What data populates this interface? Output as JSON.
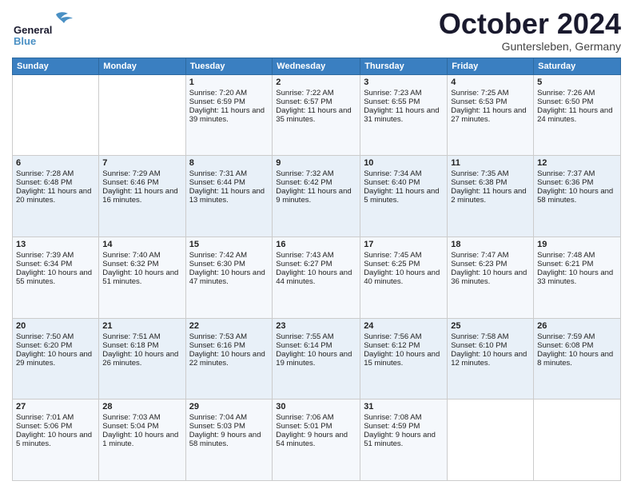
{
  "header": {
    "logo_general": "General",
    "logo_blue": "Blue",
    "month_title": "October 2024",
    "location": "Guntersleben, Germany"
  },
  "weekdays": [
    "Sunday",
    "Monday",
    "Tuesday",
    "Wednesday",
    "Thursday",
    "Friday",
    "Saturday"
  ],
  "weeks": [
    [
      {
        "day": "",
        "content": ""
      },
      {
        "day": "",
        "content": ""
      },
      {
        "day": "1",
        "content": "Sunrise: 7:20 AM\nSunset: 6:59 PM\nDaylight: 11 hours and 39 minutes."
      },
      {
        "day": "2",
        "content": "Sunrise: 7:22 AM\nSunset: 6:57 PM\nDaylight: 11 hours and 35 minutes."
      },
      {
        "day": "3",
        "content": "Sunrise: 7:23 AM\nSunset: 6:55 PM\nDaylight: 11 hours and 31 minutes."
      },
      {
        "day": "4",
        "content": "Sunrise: 7:25 AM\nSunset: 6:53 PM\nDaylight: 11 hours and 27 minutes."
      },
      {
        "day": "5",
        "content": "Sunrise: 7:26 AM\nSunset: 6:50 PM\nDaylight: 11 hours and 24 minutes."
      }
    ],
    [
      {
        "day": "6",
        "content": "Sunrise: 7:28 AM\nSunset: 6:48 PM\nDaylight: 11 hours and 20 minutes."
      },
      {
        "day": "7",
        "content": "Sunrise: 7:29 AM\nSunset: 6:46 PM\nDaylight: 11 hours and 16 minutes."
      },
      {
        "day": "8",
        "content": "Sunrise: 7:31 AM\nSunset: 6:44 PM\nDaylight: 11 hours and 13 minutes."
      },
      {
        "day": "9",
        "content": "Sunrise: 7:32 AM\nSunset: 6:42 PM\nDaylight: 11 hours and 9 minutes."
      },
      {
        "day": "10",
        "content": "Sunrise: 7:34 AM\nSunset: 6:40 PM\nDaylight: 11 hours and 5 minutes."
      },
      {
        "day": "11",
        "content": "Sunrise: 7:35 AM\nSunset: 6:38 PM\nDaylight: 11 hours and 2 minutes."
      },
      {
        "day": "12",
        "content": "Sunrise: 7:37 AM\nSunset: 6:36 PM\nDaylight: 10 hours and 58 minutes."
      }
    ],
    [
      {
        "day": "13",
        "content": "Sunrise: 7:39 AM\nSunset: 6:34 PM\nDaylight: 10 hours and 55 minutes."
      },
      {
        "day": "14",
        "content": "Sunrise: 7:40 AM\nSunset: 6:32 PM\nDaylight: 10 hours and 51 minutes."
      },
      {
        "day": "15",
        "content": "Sunrise: 7:42 AM\nSunset: 6:30 PM\nDaylight: 10 hours and 47 minutes."
      },
      {
        "day": "16",
        "content": "Sunrise: 7:43 AM\nSunset: 6:27 PM\nDaylight: 10 hours and 44 minutes."
      },
      {
        "day": "17",
        "content": "Sunrise: 7:45 AM\nSunset: 6:25 PM\nDaylight: 10 hours and 40 minutes."
      },
      {
        "day": "18",
        "content": "Sunrise: 7:47 AM\nSunset: 6:23 PM\nDaylight: 10 hours and 36 minutes."
      },
      {
        "day": "19",
        "content": "Sunrise: 7:48 AM\nSunset: 6:21 PM\nDaylight: 10 hours and 33 minutes."
      }
    ],
    [
      {
        "day": "20",
        "content": "Sunrise: 7:50 AM\nSunset: 6:20 PM\nDaylight: 10 hours and 29 minutes."
      },
      {
        "day": "21",
        "content": "Sunrise: 7:51 AM\nSunset: 6:18 PM\nDaylight: 10 hours and 26 minutes."
      },
      {
        "day": "22",
        "content": "Sunrise: 7:53 AM\nSunset: 6:16 PM\nDaylight: 10 hours and 22 minutes."
      },
      {
        "day": "23",
        "content": "Sunrise: 7:55 AM\nSunset: 6:14 PM\nDaylight: 10 hours and 19 minutes."
      },
      {
        "day": "24",
        "content": "Sunrise: 7:56 AM\nSunset: 6:12 PM\nDaylight: 10 hours and 15 minutes."
      },
      {
        "day": "25",
        "content": "Sunrise: 7:58 AM\nSunset: 6:10 PM\nDaylight: 10 hours and 12 minutes."
      },
      {
        "day": "26",
        "content": "Sunrise: 7:59 AM\nSunset: 6:08 PM\nDaylight: 10 hours and 8 minutes."
      }
    ],
    [
      {
        "day": "27",
        "content": "Sunrise: 7:01 AM\nSunset: 5:06 PM\nDaylight: 10 hours and 5 minutes."
      },
      {
        "day": "28",
        "content": "Sunrise: 7:03 AM\nSunset: 5:04 PM\nDaylight: 10 hours and 1 minute."
      },
      {
        "day": "29",
        "content": "Sunrise: 7:04 AM\nSunset: 5:03 PM\nDaylight: 9 hours and 58 minutes."
      },
      {
        "day": "30",
        "content": "Sunrise: 7:06 AM\nSunset: 5:01 PM\nDaylight: 9 hours and 54 minutes."
      },
      {
        "day": "31",
        "content": "Sunrise: 7:08 AM\nSunset: 4:59 PM\nDaylight: 9 hours and 51 minutes."
      },
      {
        "day": "",
        "content": ""
      },
      {
        "day": "",
        "content": ""
      }
    ]
  ]
}
